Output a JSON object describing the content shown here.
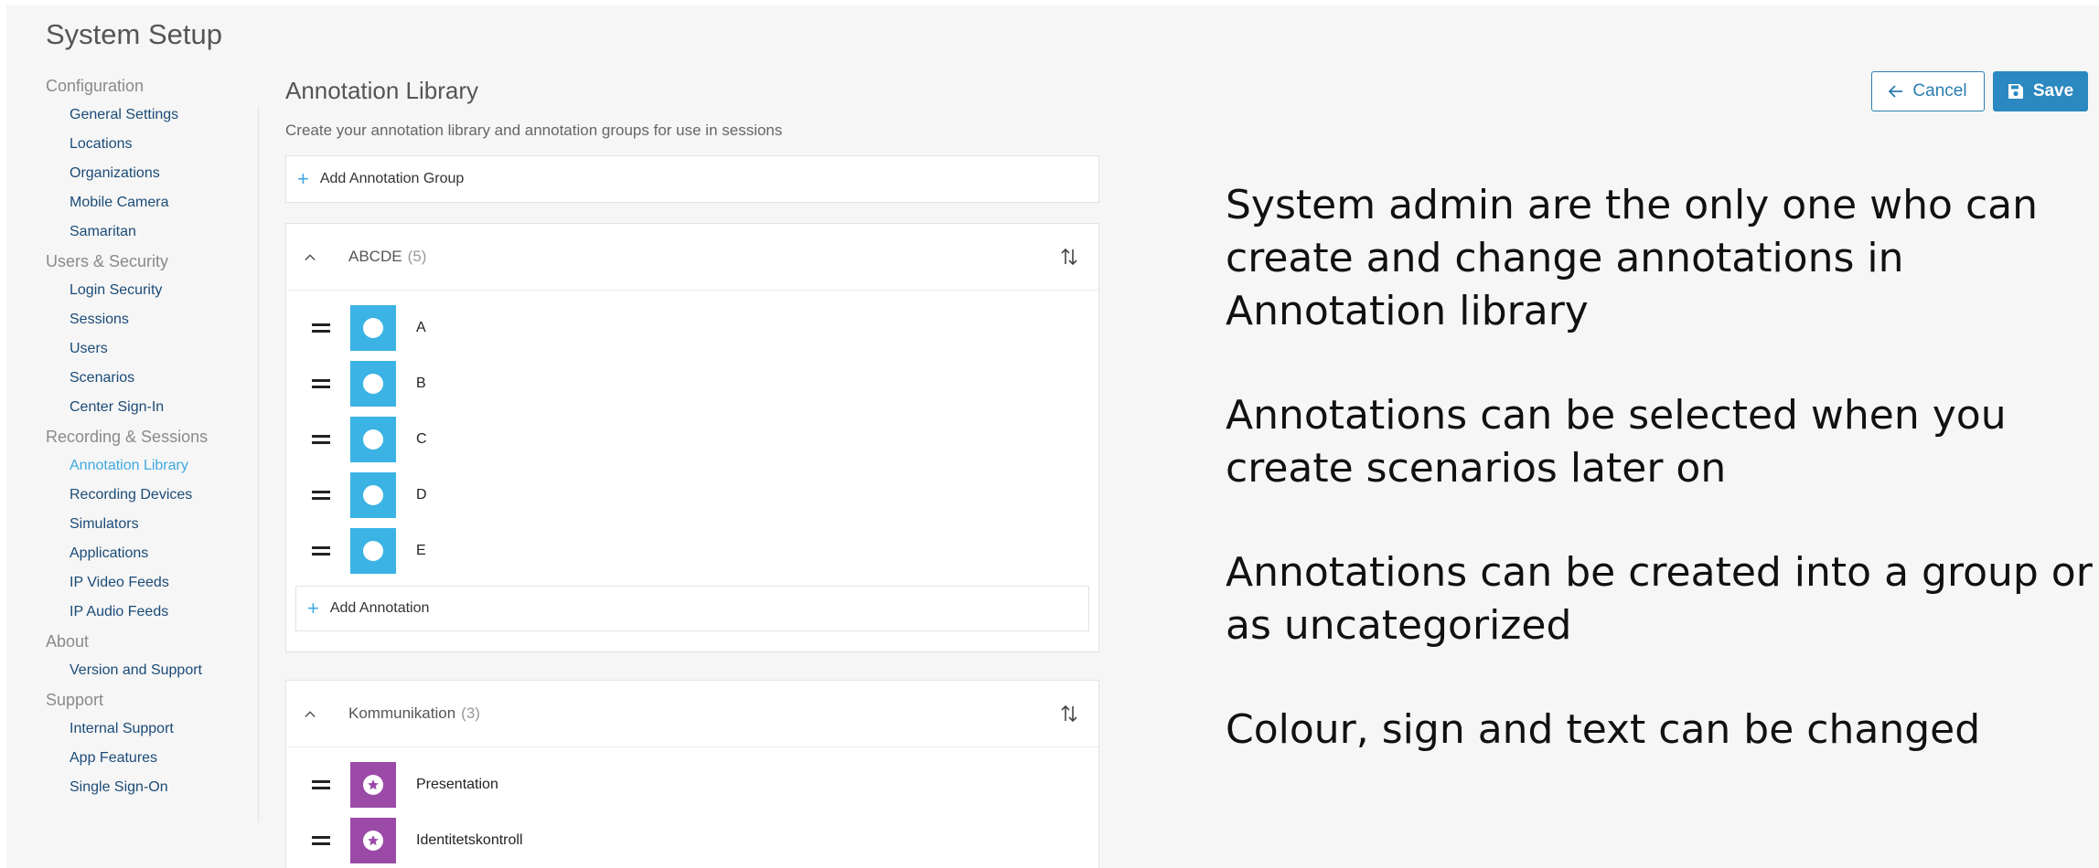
{
  "header": {
    "title": "System Setup"
  },
  "sidebar": {
    "sections": [
      {
        "label": "Configuration",
        "items": [
          "General Settings",
          "Locations",
          "Organizations",
          "Mobile Camera",
          "Samaritan"
        ]
      },
      {
        "label": "Users & Security",
        "items": [
          "Login Security",
          "Sessions",
          "Users",
          "Scenarios",
          "Center Sign-In"
        ]
      },
      {
        "label": "Recording & Sessions",
        "items": [
          "Annotation Library",
          "Recording Devices",
          "Simulators",
          "Applications",
          "IP Video Feeds",
          "IP Audio Feeds"
        ]
      },
      {
        "label": "About",
        "items": [
          "Version and Support"
        ]
      },
      {
        "label": "Support",
        "items": [
          "Internal Support",
          "App Features",
          "Single Sign-On"
        ]
      }
    ],
    "active_item": "Annotation Library"
  },
  "main": {
    "title": "Annotation Library",
    "subtitle": "Create your annotation library and annotation groups for use in sessions",
    "add_group_label": "Add Annotation Group",
    "add_annotation_label": "Add Annotation",
    "groups": [
      {
        "name": "ABCDE",
        "count": "(5)",
        "color": "#3bb3e4",
        "icon": "circle-icon",
        "annotations": [
          "A",
          "B",
          "C",
          "D",
          "E"
        ]
      },
      {
        "name": "Kommunikation",
        "count": "(3)",
        "color": "#9b4aa8",
        "icon": "star-circle-icon",
        "annotations": [
          "Presentation",
          "Identitetskontroll"
        ]
      }
    ]
  },
  "actions": {
    "cancel_label": "Cancel",
    "save_label": "Save"
  },
  "notes": [
    "System admin are the only one who can create and change annotations in Annotation library",
    "Annotations can be selected when you create scenarios later on",
    "Annotations can be created into a group or as uncategorized",
    "Colour, sign and text can be changed"
  ],
  "colors": {
    "accent": "#3fa9e0",
    "primary_button": "#2b88c0",
    "link": "#1b4b77"
  }
}
